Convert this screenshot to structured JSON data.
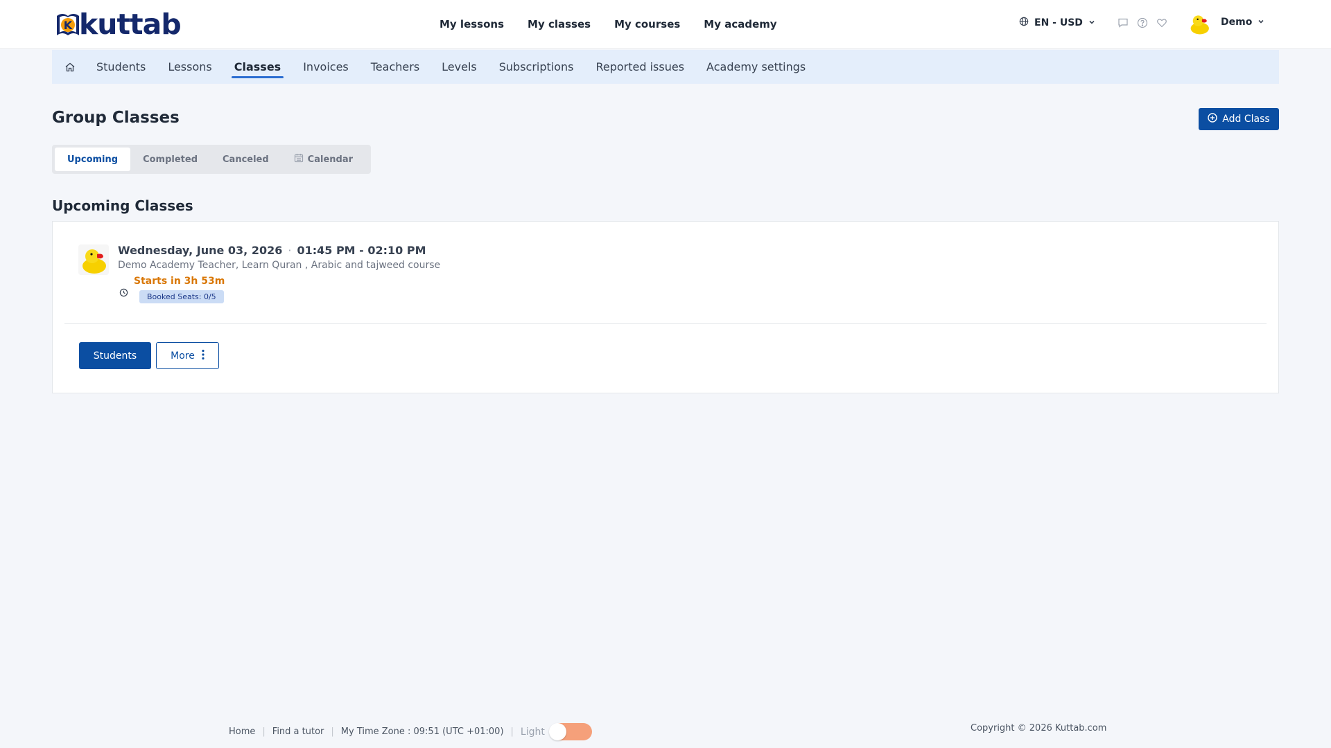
{
  "header": {
    "logo_text": "kuttab",
    "logo_letter": "K",
    "nav": [
      "My lessons",
      "My classes",
      "My courses",
      "My academy"
    ],
    "lang_currency": "EN - USD",
    "user_name": "Demo"
  },
  "subnav": {
    "items": [
      "Students",
      "Lessons",
      "Classes",
      "Invoices",
      "Teachers",
      "Levels",
      "Subscriptions",
      "Reported issues",
      "Academy settings"
    ],
    "active": "Classes"
  },
  "page": {
    "title": "Group Classes",
    "add_button": "Add Class",
    "tabs": [
      "Upcoming",
      "Completed",
      "Canceled",
      "Calendar"
    ],
    "active_tab": "Upcoming",
    "section_title": "Upcoming Classes"
  },
  "classes": [
    {
      "date": "Wednesday, June 03, 2026",
      "separator": "·",
      "time": "01:45 PM - 02:10 PM",
      "description": "Demo Academy Teacher, Learn Quran , Arabic and tajweed course",
      "starts_in": "Starts in 3h 53m",
      "booked_seats": "Booked Seats: 0/5",
      "students_button": "Students",
      "more_button": "More"
    }
  ],
  "footer": {
    "links": [
      "Home",
      "Find a tutor"
    ],
    "timezone": "My Time Zone : 09:51 (UTC +01:00)",
    "theme_label": "Light",
    "copyright": "Copyright © 2026 Kuttab.com"
  },
  "colors": {
    "primary": "#0b4ea2",
    "brand_navy": "#14286b",
    "warning": "#d97706",
    "subnav_bg": "#e4eefb",
    "toggle": "#f5a07a"
  },
  "icons": [
    "globe-icon",
    "chevron-down-icon",
    "chat-icon",
    "help-icon",
    "heart-icon",
    "home-icon",
    "plus-circle-icon",
    "calendar-icon",
    "clock-icon",
    "vertical-dots-icon",
    "duck-avatar"
  ]
}
